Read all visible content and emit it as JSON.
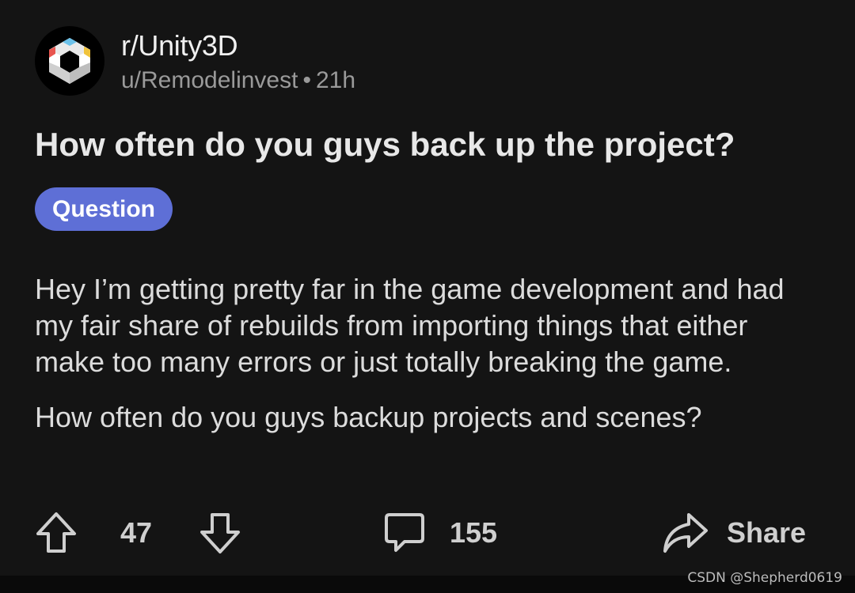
{
  "header": {
    "subreddit": "r/Unity3D",
    "author": "u/Remodelinvest",
    "separator": "•",
    "time": "21h",
    "avatar_icon": "unity-logo-icon"
  },
  "post": {
    "title": "How often do you guys back up the project?",
    "flair": "Question",
    "flair_color": "#5e6fd6",
    "body_paragraphs": [
      "Hey I’m getting pretty far in the game development and had my fair share of rebuilds from importing things that either make too many errors or just totally breaking the game.",
      "How often do you guys backup projects and scenes?"
    ]
  },
  "actions": {
    "upvote_icon": "upvote-arrow-icon",
    "vote_count": "47",
    "downvote_icon": "downvote-arrow-icon",
    "comment_icon": "comment-bubble-icon",
    "comment_count": "155",
    "share_icon": "share-arrow-icon",
    "share_label": "Share"
  },
  "watermark": "CSDN @Shepherd0619"
}
